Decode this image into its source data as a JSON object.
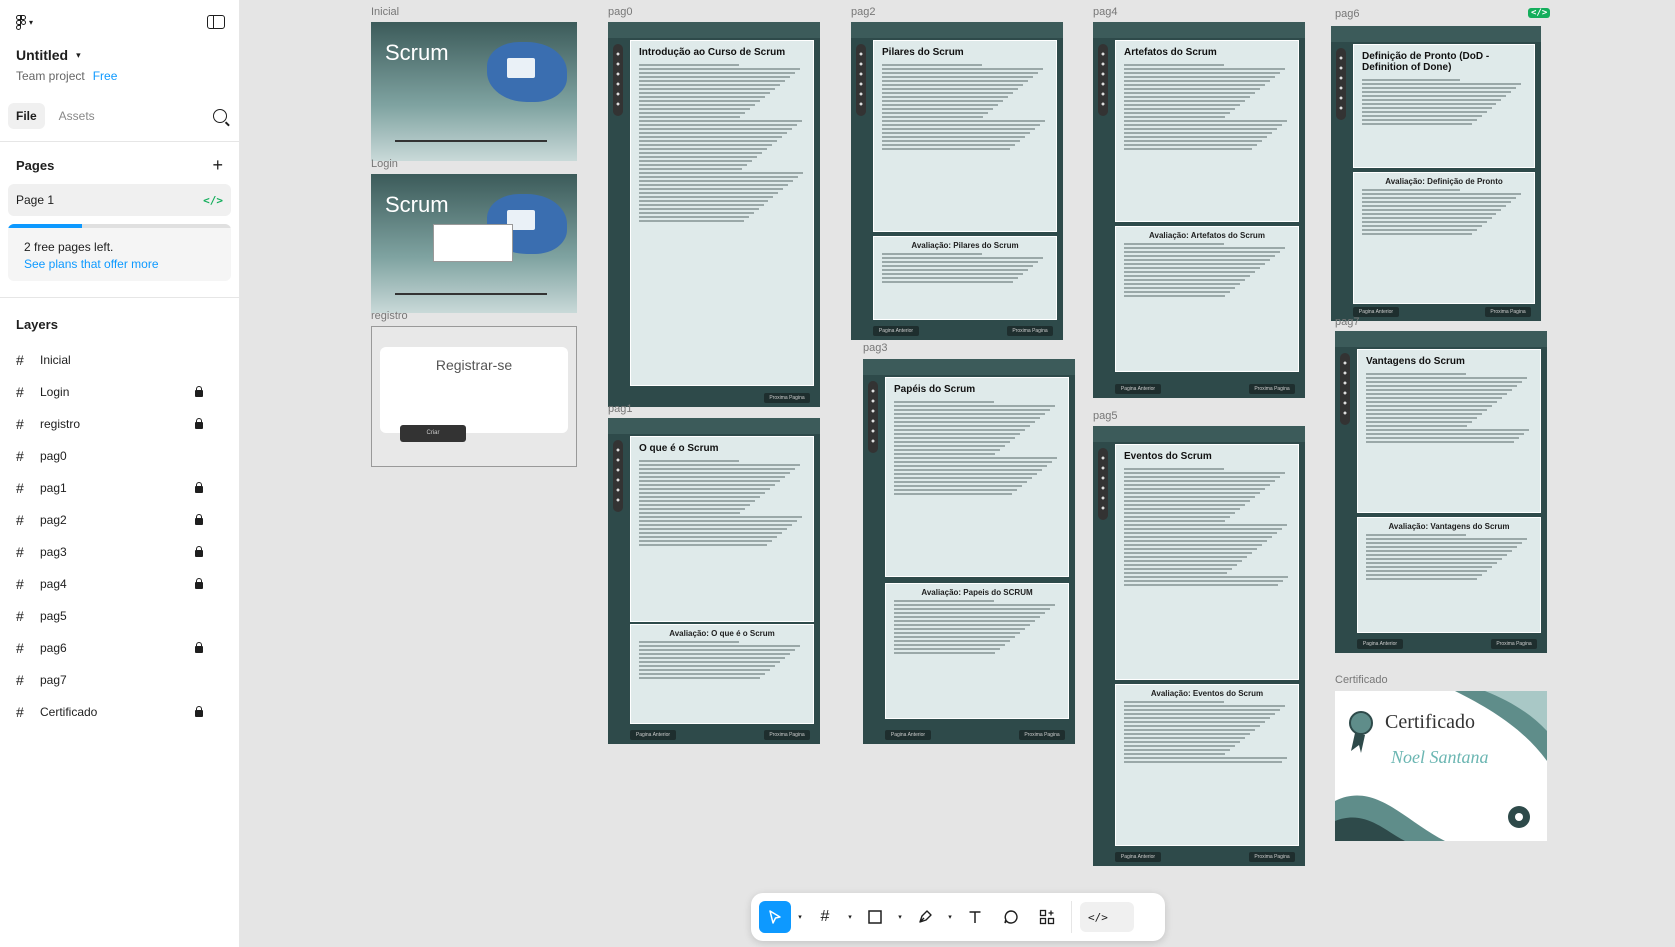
{
  "file": {
    "title": "Untitled",
    "team": "Team project",
    "plan": "Free"
  },
  "tabs": {
    "file": "File",
    "assets": "Assets"
  },
  "pages": {
    "heading": "Pages",
    "items": [
      {
        "label": "Page 1"
      }
    ],
    "limit_text": "2 free pages left.",
    "limit_link": "See plans that offer more",
    "free_pages_used_fraction": 0.33
  },
  "layers": {
    "heading": "Layers",
    "items": [
      {
        "label": "Inicial",
        "locked": false
      },
      {
        "label": "Login",
        "locked": true
      },
      {
        "label": "registro",
        "locked": true
      },
      {
        "label": "pag0",
        "locked": false
      },
      {
        "label": "pag1",
        "locked": true
      },
      {
        "label": "pag2",
        "locked": true
      },
      {
        "label": "pag3",
        "locked": true
      },
      {
        "label": "pag4",
        "locked": true
      },
      {
        "label": "pag5",
        "locked": false
      },
      {
        "label": "pag6",
        "locked": true
      },
      {
        "label": "pag7",
        "locked": false
      },
      {
        "label": "Certificado",
        "locked": true
      }
    ]
  },
  "frames": {
    "inicial": {
      "label": "Inicial",
      "brand": "Scrum"
    },
    "login": {
      "label": "Login",
      "brand": "Scrum"
    },
    "registro": {
      "label": "registro",
      "title": "Registrar-se",
      "button": "Criar"
    },
    "pag0": {
      "label": "pag0",
      "title": "Introdução ao Curso de Scrum"
    },
    "pag1": {
      "label": "pag1",
      "title": "O que é o Scrum",
      "quiz": "Avaliação: O que é o Scrum"
    },
    "pag2": {
      "label": "pag2",
      "title": "Pilares do Scrum",
      "quiz": "Avaliação: Pilares do Scrum"
    },
    "pag3": {
      "label": "pag3",
      "title": "Papéis do Scrum",
      "quiz": "Avaliação: Papeis do SCRUM"
    },
    "pag4": {
      "label": "pag4",
      "title": "Artefatos do Scrum",
      "quiz": "Avaliação: Artefatos do Scrum"
    },
    "pag5": {
      "label": "pag5",
      "title": "Eventos do Scrum",
      "quiz": "Avaliação: Eventos do Scrum"
    },
    "pag6": {
      "label": "pag6",
      "title": "Definição de Pronto (DoD - Definition of Done)",
      "quiz": "Avaliação: Definição de Pronto"
    },
    "pag7": {
      "label": "pag7",
      "title": "Vantagens do Scrum",
      "quiz": "Avaliação: Vantagens do Scrum"
    },
    "certificado": {
      "label": "Certificado",
      "title": "Certificado",
      "signature": "Noel Santana"
    }
  },
  "nav_buttons": {
    "prev": "Pagina Anterior",
    "next": "Proxima Pagina"
  },
  "toolbar": {
    "tools": [
      "move-tool",
      "frame-tool",
      "shape-tool",
      "pen-tool",
      "text-tool",
      "comment-tool",
      "actions-tool"
    ],
    "dev_mode": "</>"
  },
  "colors": {
    "accent": "#0d99ff",
    "dev_green": "#14ae5c",
    "frame_dark": "#2e4a4a"
  }
}
